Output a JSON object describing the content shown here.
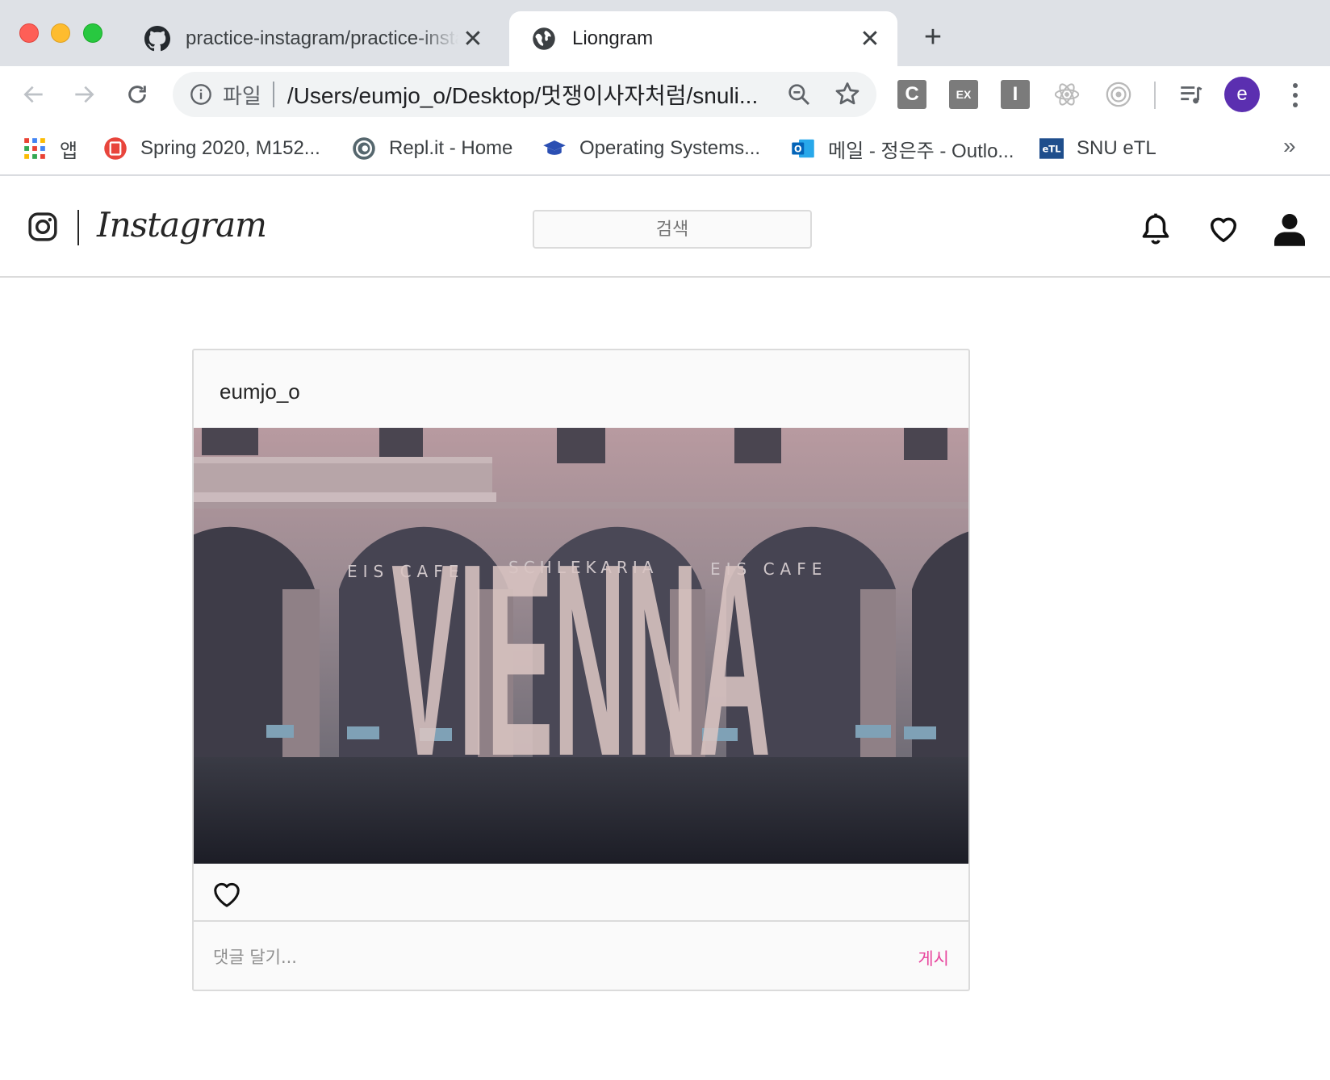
{
  "browser": {
    "tabs": [
      {
        "title": "practice-instagram/practice-insta",
        "favicon": "github-icon",
        "active": false
      },
      {
        "title": "Liongram",
        "favicon": "globe-icon",
        "active": true
      }
    ],
    "address_bar": {
      "scheme_label": "파일",
      "url": "/Users/eumjo_o/Desktop/멋쟁이사자처럼/snuli..."
    },
    "extensions": [
      {
        "name": "c-extension-icon",
        "label": "C"
      },
      {
        "name": "ex-extension-icon",
        "label": "EX"
      },
      {
        "name": "i-extension-icon",
        "label": "I"
      },
      {
        "name": "react-devtools-icon",
        "label": ""
      },
      {
        "name": "target-extension-icon",
        "label": ""
      },
      {
        "name": "media-control-icon",
        "label": ""
      }
    ],
    "profile_initial": "e",
    "profile_color": "#5b2fb0",
    "bookmarks": [
      {
        "label": "앱",
        "icon": "apps-grid-icon"
      },
      {
        "label": "Spring 2020, M152...",
        "icon": "red-square-icon"
      },
      {
        "label": "Repl.it - Home",
        "icon": "replit-icon"
      },
      {
        "label": "Operating Systems...",
        "icon": "graduation-cap-icon"
      },
      {
        "label": "메일 - 정은주 - Outlo...",
        "icon": "outlook-icon"
      },
      {
        "label": "SNU eTL",
        "icon": "etl-icon"
      }
    ],
    "bookmarks_overflow": "»"
  },
  "app": {
    "brand": "Instagram",
    "search_placeholder": "검색",
    "header_icons": [
      "bell-icon",
      "heart-icon",
      "user-icon"
    ]
  },
  "post": {
    "username": "eumjo_o",
    "image": {
      "headline": "VIENNA",
      "signs": [
        "EIS CAFE",
        "SCHLEKARIA",
        "EIS CAFE"
      ]
    },
    "comment_placeholder": "댓글 달기...",
    "submit_label": "게시",
    "accent_color": "#e8479e"
  }
}
